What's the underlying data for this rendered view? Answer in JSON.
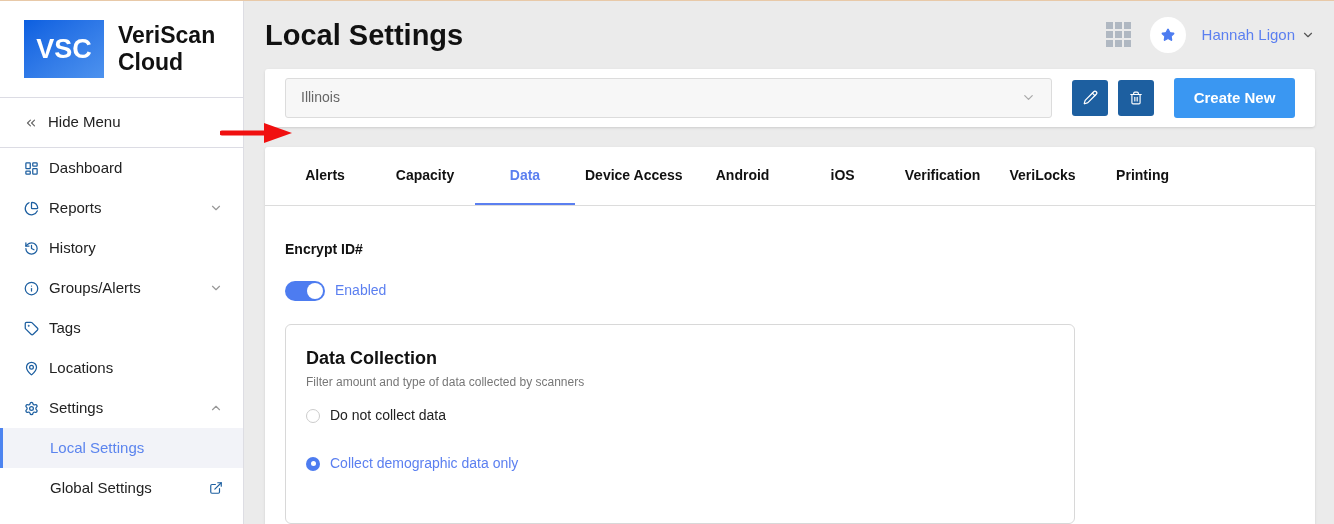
{
  "brand": {
    "logo_text": "VSC",
    "name": "VeriScan Cloud"
  },
  "sidebar": {
    "hide_menu": "Hide Menu",
    "items": [
      {
        "kind": "dashboard",
        "label": "Dashboard"
      },
      {
        "kind": "reports",
        "label": "Reports",
        "expanded": false
      },
      {
        "kind": "history",
        "label": "History"
      },
      {
        "kind": "info",
        "label": "Groups/Alerts",
        "expanded": false
      },
      {
        "kind": "tag",
        "label": "Tags"
      },
      {
        "kind": "pin",
        "label": "Locations"
      },
      {
        "kind": "gear",
        "label": "Settings",
        "expanded": true,
        "children": [
          {
            "label": "Local Settings",
            "selected": true,
            "external": false
          },
          {
            "label": "Global Settings",
            "selected": false,
            "external": true
          }
        ]
      }
    ]
  },
  "header": {
    "title": "Local Settings",
    "user": "Hannah Ligon"
  },
  "location_select": {
    "value": "Illinois"
  },
  "create_button": "Create New",
  "tabs": [
    {
      "label": "Alerts",
      "selected": false
    },
    {
      "label": "Capacity",
      "selected": false
    },
    {
      "label": "Data",
      "selected": true
    },
    {
      "label": "Device Access",
      "selected": false
    },
    {
      "label": "Android",
      "selected": false
    },
    {
      "label": "iOS",
      "selected": false
    },
    {
      "label": "Verification",
      "selected": false
    },
    {
      "label": "VeriLocks",
      "selected": false
    },
    {
      "label": "Printing",
      "selected": false
    }
  ],
  "encrypt": {
    "label": "Encrypt ID#",
    "on": true,
    "state_text": "Enabled"
  },
  "data_collection": {
    "title": "Data Collection",
    "subtitle": "Filter amount and type of data collected by scanners",
    "options": [
      {
        "label": "Do not collect data",
        "selected": false
      },
      {
        "label": "Collect demographic data only",
        "selected": true
      }
    ]
  }
}
